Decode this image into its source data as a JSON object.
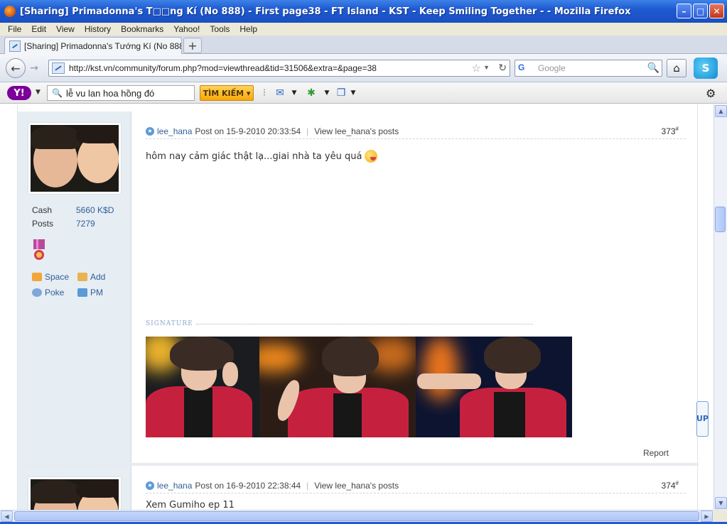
{
  "window": {
    "title": "[Sharing] Primadonna's T□□ng Kí (No 888) - First page38 - FT Island - KST - Keep Smiling Together - - Mozilla Firefox",
    "minimize": "–",
    "maximize": "□",
    "close": "✕"
  },
  "menu": [
    "File",
    "Edit",
    "View",
    "History",
    "Bookmarks",
    "Yahoo!",
    "Tools",
    "Help"
  ],
  "tab": {
    "label": "[Sharing] Primadonna's Tướng Kí (No 888) - ...",
    "new_tab": "+"
  },
  "nav": {
    "url": "http://kst.vn/community/forum.php?mod=viewthread&tid=31506&extra=&page=38",
    "search_placeholder": "Google",
    "search_engine": "G"
  },
  "yahoo": {
    "logo": "Y!",
    "query": "lễ vu lan hoa hồng đó",
    "button": "TÌM KIẾM ▾"
  },
  "posts": [
    {
      "author": "lee_hana",
      "posted": "Post on 15-9-2010 20:33:54",
      "view_posts": "View lee_hana's posts",
      "floor": "373",
      "floor_sup": "#",
      "message": "hôm nay cảm giác thật lạ...giai nhà ta yêu quá",
      "cash_label": "Cash",
      "cash_value": "5660 K$D",
      "posts_label": "Posts",
      "posts_value": "7279",
      "link_space": "Space",
      "link_add": "Add",
      "link_poke": "Poke",
      "link_pm": "PM",
      "signature_label": "SIGNATURE",
      "report": "Report"
    },
    {
      "author": "lee_hana",
      "posted": "Post on 16-9-2010 22:38:44",
      "view_posts": "View lee_hana's posts",
      "floor": "374",
      "floor_sup": "#",
      "message": "Xem Gumiho ep 11"
    }
  ],
  "up_button": "UP"
}
